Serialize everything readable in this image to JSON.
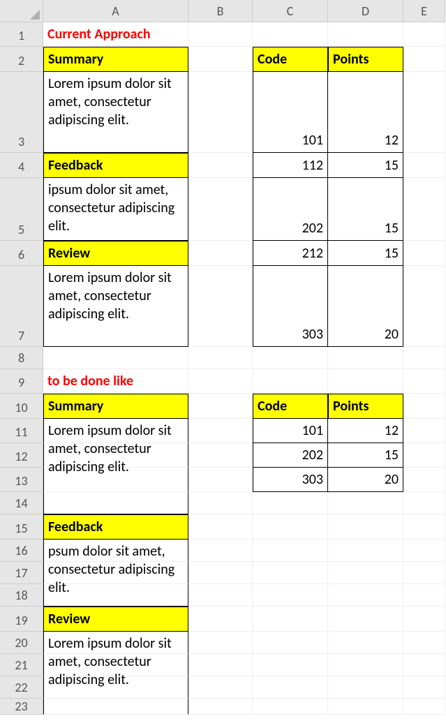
{
  "columns": [
    "A",
    "B",
    "C",
    "D",
    "E"
  ],
  "rowCount": 23,
  "block1": {
    "title": "Current Approach",
    "a2": "Summary",
    "a3": "Lorem ipsum dolor sit amet, consectetur adipiscing elit.",
    "a4": "Feedback",
    "a5": "ipsum dolor sit amet, consectetur adipiscing elit.",
    "a6": "Review",
    "a7": "Lorem ipsum dolor sit amet, consectetur adipiscing elit.",
    "c2": "Code",
    "d2": "Points",
    "table": [
      {
        "code": "101",
        "points": "12"
      },
      {
        "code": "112",
        "points": "15"
      },
      {
        "code": "202",
        "points": "15"
      },
      {
        "code": "212",
        "points": "15"
      },
      {
        "code": "303",
        "points": "20"
      }
    ]
  },
  "block2": {
    "title": "to be done like",
    "a10": "Summary",
    "mergeA11": "Lorem ipsum dolor sit amet, consectetur adipiscing elit.",
    "a15": "Feedback",
    "mergeA16": "psum dolor sit amet, consectetur adipiscing elit.",
    "a19": "Review",
    "mergeA20": "Lorem ipsum dolor sit amet, consectetur adipiscing elit.",
    "c10": "Code",
    "d10": "Points",
    "table": [
      {
        "code": "101",
        "points": "12"
      },
      {
        "code": "202",
        "points": "15"
      },
      {
        "code": "303",
        "points": "20"
      }
    ]
  }
}
